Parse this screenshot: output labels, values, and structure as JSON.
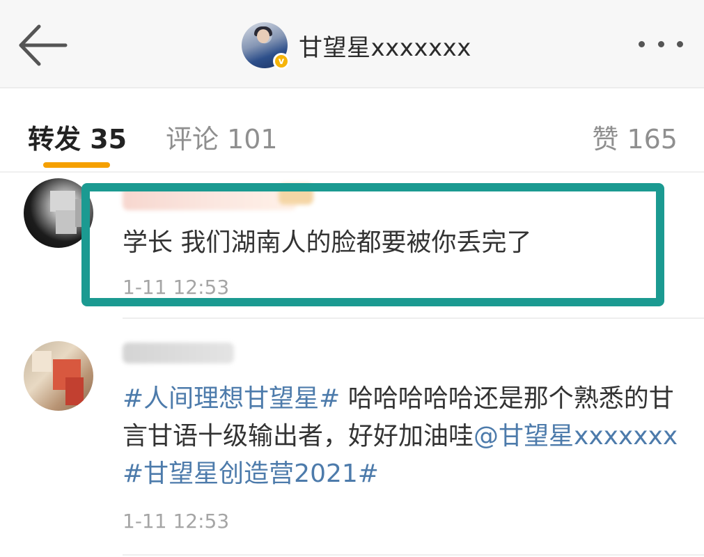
{
  "header": {
    "back_icon": "arrow-left-icon",
    "title": "甘望星xxxxxxx",
    "verified_icon": "verified-badge-icon",
    "verified_glyph": "v",
    "more_icon": "more-dots-icon"
  },
  "tabs": {
    "repost_label": "转发 35",
    "comment_label": "评论 101",
    "like_label": "赞 165",
    "active_color": "#f5a000"
  },
  "comments": [
    {
      "text": "学长 我们湖南人的脸都要被你丢完了",
      "time": "1-11 12:53"
    },
    {
      "tag1": "#人间理想甘望星#",
      "text_part1": " 哈哈哈哈哈还是那个熟悉的甘言甘语十级输出者，好好加油哇",
      "mention": "@甘望星xxxxxxx",
      "tag2": " #甘望星创造营2021#",
      "time": "1-11 12:53"
    }
  ],
  "colors": {
    "highlight_border": "#1b9a91",
    "link_blue": "#4d7bab",
    "verified_gold": "#f5b40a"
  }
}
